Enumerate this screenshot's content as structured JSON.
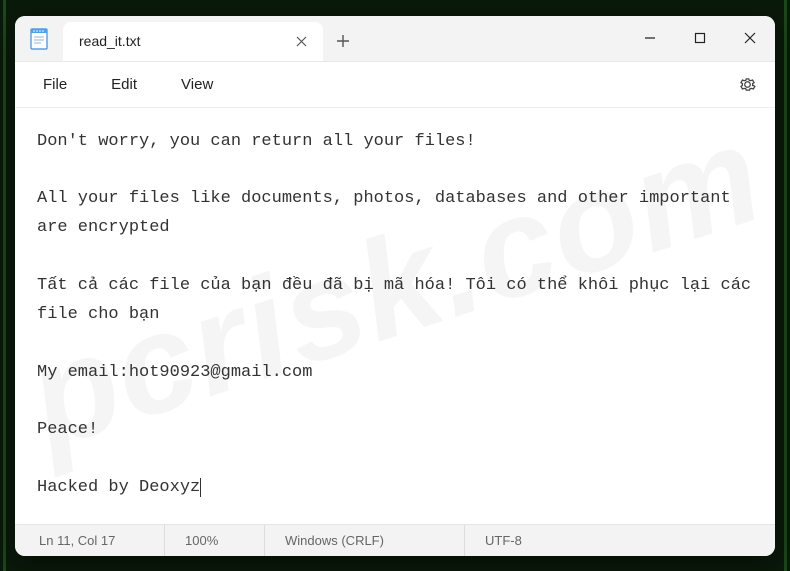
{
  "tab": {
    "title": "read_it.txt"
  },
  "menu": {
    "file": "File",
    "edit": "Edit",
    "view": "View"
  },
  "content": "Don't worry, you can return all your files!\n\nAll your files like documents, photos, databases and other important are encrypted\n\nTất cả các file của bạn đều đã bị mã hóa! Tôi có thể khôi phục lại các file cho bạn\n\nMy email:hot90923@gmail.com\n\nPeace!\n\nHacked by Deoxyz",
  "status": {
    "position": "Ln 11, Col 17",
    "zoom": "100%",
    "eol": "Windows (CRLF)",
    "encoding": "UTF-8"
  },
  "watermark": "pcrisk.com"
}
